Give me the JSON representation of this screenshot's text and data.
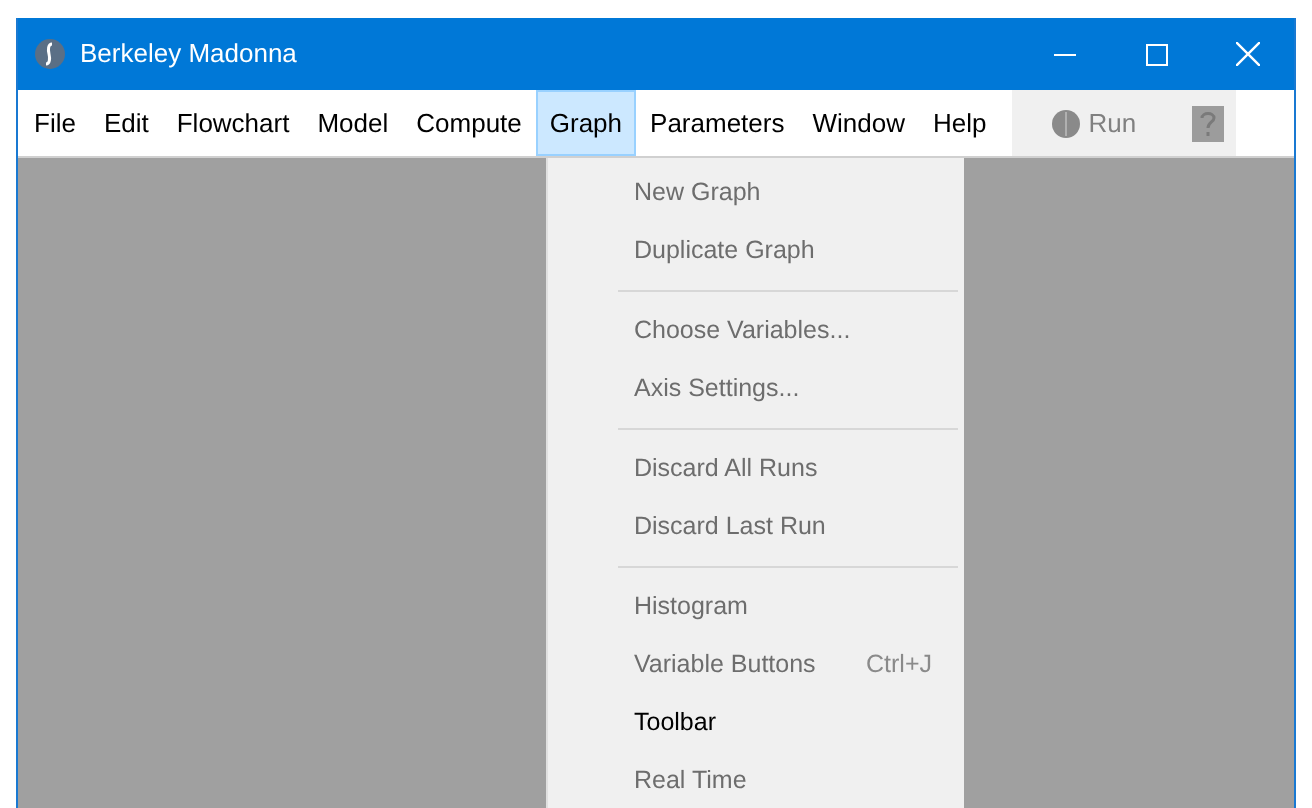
{
  "window": {
    "title": "Berkeley Madonna"
  },
  "menu_bar": [
    {
      "label": "File",
      "selected": false
    },
    {
      "label": "Edit",
      "selected": false
    },
    {
      "label": "Flowchart",
      "selected": false
    },
    {
      "label": "Model",
      "selected": false
    },
    {
      "label": "Compute",
      "selected": false
    },
    {
      "label": "Graph",
      "selected": true
    },
    {
      "label": "Parameters",
      "selected": false
    },
    {
      "label": "Window",
      "selected": false
    },
    {
      "label": "Help",
      "selected": false
    }
  ],
  "toolbar": {
    "run_button": {
      "label": "Run",
      "disabled": true
    }
  },
  "graph_menu": [
    {
      "kind": "item",
      "label": "New Graph",
      "disabled": true
    },
    {
      "kind": "item",
      "label": "Duplicate Graph",
      "disabled": true
    },
    {
      "kind": "separator"
    },
    {
      "kind": "item",
      "label": "Choose Variables...",
      "disabled": true
    },
    {
      "kind": "item",
      "label": "Axis Settings...",
      "disabled": true
    },
    {
      "kind": "separator"
    },
    {
      "kind": "item",
      "label": "Discard All Runs",
      "disabled": true
    },
    {
      "kind": "item",
      "label": "Discard Last Run",
      "disabled": true
    },
    {
      "kind": "separator"
    },
    {
      "kind": "item",
      "label": "Histogram",
      "disabled": true
    },
    {
      "kind": "item",
      "label": "Variable Buttons",
      "shortcut": "Ctrl+J",
      "disabled": true
    },
    {
      "kind": "item",
      "label": "Toolbar",
      "disabled": false
    },
    {
      "kind": "item",
      "label": "Real Time",
      "disabled": true
    }
  ]
}
